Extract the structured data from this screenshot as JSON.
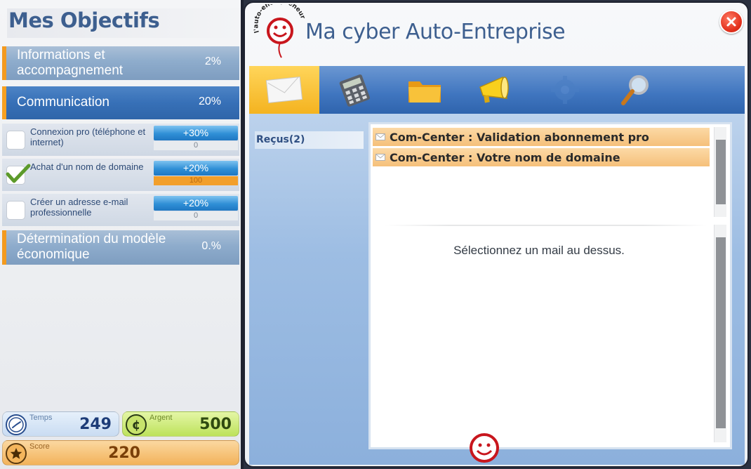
{
  "left_panel": {
    "title": "Mes Objectifs",
    "goals": [
      {
        "label": "Informations et accompagnement",
        "pct": "2%"
      },
      {
        "label": "Communication",
        "pct": "20%"
      },
      {
        "label": "Détermination du modèle économique",
        "pct": "0.%"
      }
    ],
    "sub_goals": [
      {
        "label": "Connexion pro (téléphone et internet)",
        "gain": "+30%",
        "progress_text": "0",
        "progress": 0,
        "checked": false
      },
      {
        "label": "Achat d'un nom de domaine",
        "gain": "+20%",
        "progress_text": "100",
        "progress": 100,
        "checked": true
      },
      {
        "label": "Créer un adresse e-mail professionnelle",
        "gain": "+20%",
        "progress_text": "0",
        "progress": 0,
        "checked": false
      }
    ],
    "stats": {
      "time_label": "Temps",
      "time_value": "249",
      "money_label": "Argent",
      "money_value": "500",
      "money_icon": "¢",
      "score_label": "Score",
      "score_value": "220"
    }
  },
  "window": {
    "title": "Ma cyber Auto-Entreprise",
    "logo_text": "l'auto-entrepreneur",
    "toolbar_icons": [
      "mail-icon",
      "calculator-icon",
      "folder-icon",
      "megaphone-icon",
      "gear-icon",
      "magnifier-icon"
    ],
    "folder": "Reçus(2)",
    "mails": [
      {
        "subject": "Com-Center : Validation abonnement pro"
      },
      {
        "subject": "Com-Center : Votre nom de domaine"
      }
    ],
    "placeholder": "Sélectionnez un mail au dessus."
  },
  "colors": {
    "accent_orange": "#f39a1f",
    "title_blue": "#3d5f8f",
    "toolbar_blue": "#3f75bf",
    "mail_row": "#f5c07a",
    "close_red": "#e2301c"
  }
}
